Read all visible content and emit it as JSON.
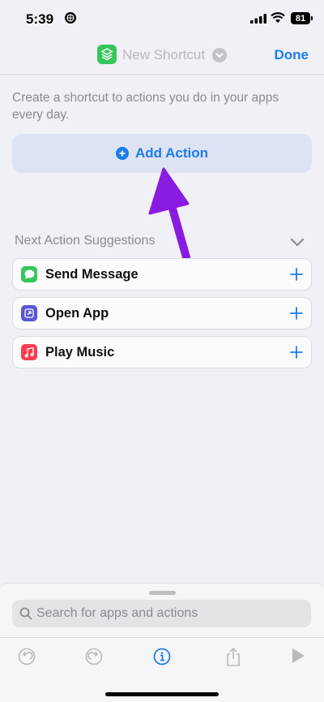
{
  "status_bar": {
    "time": "5:39",
    "battery": "81"
  },
  "header": {
    "title": "New Shortcut",
    "done_label": "Done"
  },
  "main": {
    "intro_text": "Create a shortcut to actions you do in your apps every day.",
    "add_action_label": "Add Action",
    "suggestions_title": "Next Action Suggestions",
    "suggestions": [
      {
        "label": "Send Message",
        "icon": "messages-icon",
        "color": "#34c759"
      },
      {
        "label": "Open App",
        "icon": "open-app-icon",
        "color": "#5856d6"
      },
      {
        "label": "Play Music",
        "icon": "music-icon",
        "color": "#fa3c4f"
      }
    ]
  },
  "bottom": {
    "search_placeholder": "Search for apps and actions",
    "toolbar": [
      "undo-icon",
      "redo-icon",
      "info-icon",
      "share-icon",
      "play-icon"
    ]
  },
  "colors": {
    "accent": "#1a7cf0",
    "annotation_arrow": "#8a1be0",
    "background": "#f1f0f6"
  }
}
